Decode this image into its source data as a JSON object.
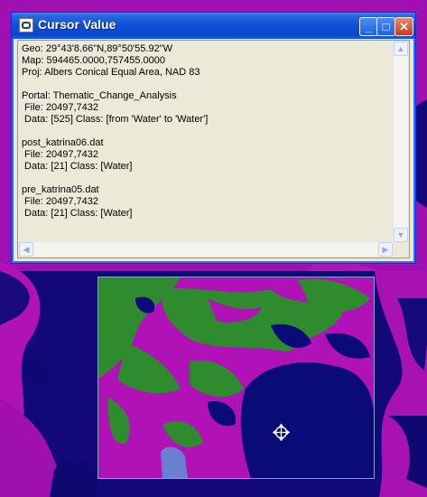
{
  "window": {
    "title": "Cursor Value",
    "minimize_glyph": "_",
    "maximize_glyph": "□",
    "close_glyph": "✕"
  },
  "cursor_info": {
    "geo": "Geo: 29°43'8.66\"N,89°50'55.92\"W",
    "map": "Map: 594465.0000,757455.0000",
    "proj": "Proj: Albers Conical Equal Area, NAD 83",
    "portal": "Portal: Thematic_Change_Analysis",
    "portal_file": " File: 20497,7432",
    "portal_data": " Data: [525] Class: [from 'Water' to 'Water']",
    "post_name": "post_katrina06.dat",
    "post_file": " File: 20497,7432",
    "post_data": " Data: [21] Class: [Water]",
    "pre_name": "pre_katrina05.dat",
    "pre_file": " File: 20497,7432",
    "pre_data": " Data: [21] Class: [Water]"
  },
  "scrollbar": {
    "up_arrow": "▲",
    "down_arrow": "▼",
    "left_arrow": "◀",
    "right_arrow": "▶"
  },
  "colors": {
    "water": "#0a0a78",
    "change": "#b40ab4",
    "vegetation": "#2e8b2e",
    "light": "#6a7fd0"
  },
  "icons": {
    "move_cursor": "move-crosshair-icon"
  }
}
